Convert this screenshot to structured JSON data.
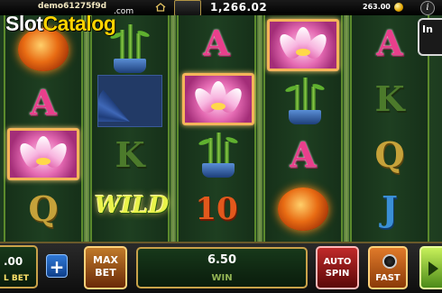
{
  "topbar": {
    "username": "demo61275f9d",
    "balance": "1,266.02",
    "credits": "263.00",
    "info_label": "i"
  },
  "watermark": {
    "slot": "Slot",
    "catalog": "Catalog",
    "com": ".com"
  },
  "side_tab": {
    "label": "In"
  },
  "reels": {
    "wild": "WILD",
    "letters": {
      "a": "A",
      "k": "K",
      "q": "Q",
      "j": "J",
      "ten": "10"
    }
  },
  "bottombar": {
    "bet_value": ".00",
    "bet_label": "L BET",
    "plus_label": "+",
    "maxbet_label_1": "MAX",
    "maxbet_label_2": "BET",
    "win_value": "6.50",
    "win_label": "WIN",
    "autospin_label_1": "AUTO",
    "autospin_label_2": "SPIN",
    "fast_label": "FAST"
  },
  "colors": {
    "accent_gold": "#c9a24a",
    "reel_green": "#1e3f21",
    "letter_pink": "#e93f8c",
    "win_green": "#bde36a"
  }
}
